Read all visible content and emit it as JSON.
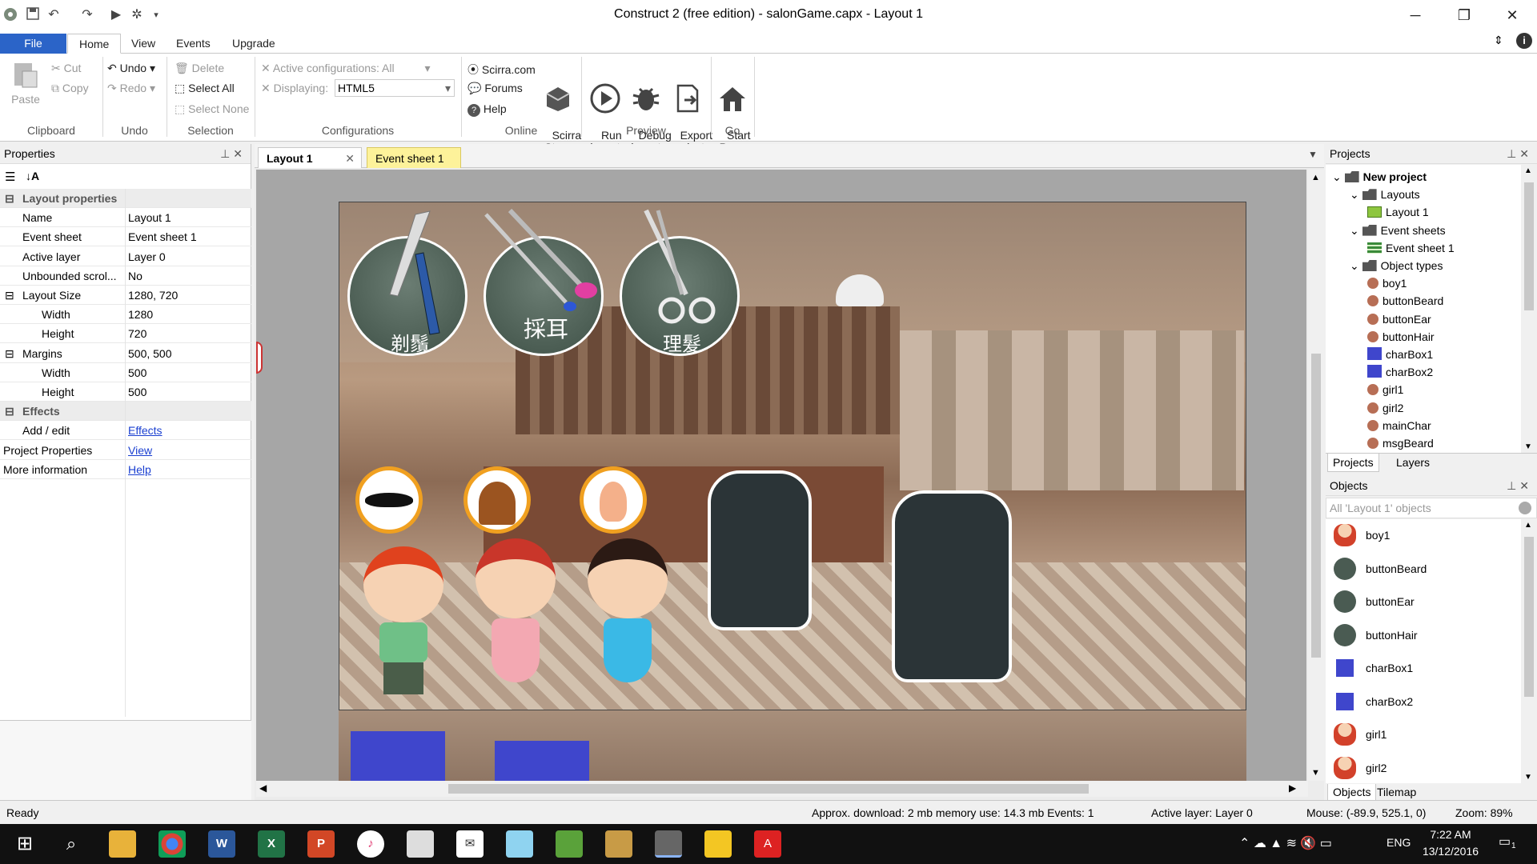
{
  "window": {
    "title": "Construct 2  (free edition) - salonGame.capx - Layout 1"
  },
  "ribbon_tabs": [
    "File",
    "Home",
    "View",
    "Events",
    "Upgrade"
  ],
  "clipboard": {
    "paste": "Paste",
    "cut": "Cut",
    "copy": "Copy",
    "label": "Clipboard"
  },
  "undo": {
    "undo": "Undo",
    "redo": "Redo",
    "label": "Undo"
  },
  "selection": {
    "delete": "Delete",
    "select_all": "Select All",
    "select_none": "Select None",
    "label": "Selection"
  },
  "configurations": {
    "active": "Active configurations: All",
    "displaying_label": "Displaying:",
    "displaying_value": "HTML5",
    "label": "Configurations"
  },
  "online": {
    "scirra": "Scirra.com",
    "forums": "Forums",
    "help": "Help",
    "store": "Scirra\nStore",
    "label": "Online"
  },
  "preview": {
    "run": "Run\nlayout",
    "debug": "Debug\nlayout",
    "export": "Export\nproject",
    "label": "Preview"
  },
  "go": {
    "start": "Start\nPage",
    "label": "Go"
  },
  "properties": {
    "title": "Properties",
    "rows": [
      {
        "type": "cat",
        "k": "Layout properties",
        "v": ""
      },
      {
        "type": "row",
        "k": "Name",
        "v": "Layout 1"
      },
      {
        "type": "row",
        "k": "Event sheet",
        "v": "Event sheet 1"
      },
      {
        "type": "row",
        "k": "Active layer",
        "v": "Layer 0"
      },
      {
        "type": "row",
        "k": "Unbounded scrol...",
        "v": "No"
      },
      {
        "type": "row",
        "k": "Layout Size",
        "v": "1280, 720"
      },
      {
        "type": "sub",
        "k": "Width",
        "v": "1280"
      },
      {
        "type": "sub",
        "k": "Height",
        "v": "720"
      },
      {
        "type": "row",
        "k": "Margins",
        "v": "500, 500"
      },
      {
        "type": "sub",
        "k": "Width",
        "v": "500"
      },
      {
        "type": "sub",
        "k": "Height",
        "v": "500"
      },
      {
        "type": "cat",
        "k": "Effects",
        "v": ""
      },
      {
        "type": "row",
        "k": "Add / edit",
        "v": "Effects",
        "link": true
      },
      {
        "type": "top",
        "k": "Project Properties",
        "v": "View",
        "link": true
      },
      {
        "type": "top",
        "k": "More information",
        "v": "Help",
        "link": true
      }
    ]
  },
  "doc_tabs": {
    "layout": "Layout 1",
    "events": "Event sheet 1"
  },
  "scene_labels": {
    "beard": "剃鬚",
    "ear": "採耳",
    "hair": "理髮"
  },
  "projects": {
    "title": "Projects",
    "items": [
      {
        "label": "New project",
        "level": 0,
        "kind": "folder",
        "bold": true
      },
      {
        "label": "Layouts",
        "level": 1,
        "kind": "folder"
      },
      {
        "label": "Layout 1",
        "level": 2,
        "kind": "layout"
      },
      {
        "label": "Event sheets",
        "level": 1,
        "kind": "folder"
      },
      {
        "label": "Event sheet 1",
        "level": 2,
        "kind": "events"
      },
      {
        "label": "Object types",
        "level": 1,
        "kind": "folder"
      },
      {
        "label": "boy1",
        "level": 2,
        "kind": "sprite"
      },
      {
        "label": "buttonBeard",
        "level": 2,
        "kind": "sprite"
      },
      {
        "label": "buttonEar",
        "level": 2,
        "kind": "sprite"
      },
      {
        "label": "buttonHair",
        "level": 2,
        "kind": "sprite"
      },
      {
        "label": "charBox1",
        "level": 2,
        "kind": "box"
      },
      {
        "label": "charBox2",
        "level": 2,
        "kind": "box"
      },
      {
        "label": "girl1",
        "level": 2,
        "kind": "sprite"
      },
      {
        "label": "girl2",
        "level": 2,
        "kind": "sprite"
      },
      {
        "label": "mainChar",
        "level": 2,
        "kind": "sprite"
      },
      {
        "label": "msgBeard",
        "level": 2,
        "kind": "sprite"
      }
    ],
    "tab_projects": "Projects",
    "tab_layers": "Layers"
  },
  "objects": {
    "title": "Objects",
    "filter": "All 'Layout 1' objects",
    "items": [
      "boy1",
      "buttonBeard",
      "buttonEar",
      "buttonHair",
      "charBox1",
      "charBox2",
      "girl1",
      "girl2"
    ],
    "tab_objects": "Objects",
    "tab_tilemap": "Tilemap"
  },
  "status": {
    "ready": "Ready",
    "download": "Approx. download: 2 mb  memory use: 14.3 mb  Events: 1",
    "layer": "Active layer: Layer 0",
    "mouse": "Mouse: (-89.9, 525.1, 0)",
    "zoom": "Zoom: 89%"
  },
  "taskbar": {
    "lang": "ENG",
    "time": "7:22 AM",
    "date": "13/12/2016",
    "notif": "1"
  },
  "colors": {
    "accent": "#2b64c8",
    "charbox": "#3f46cc",
    "link": "#1a3fd0"
  }
}
